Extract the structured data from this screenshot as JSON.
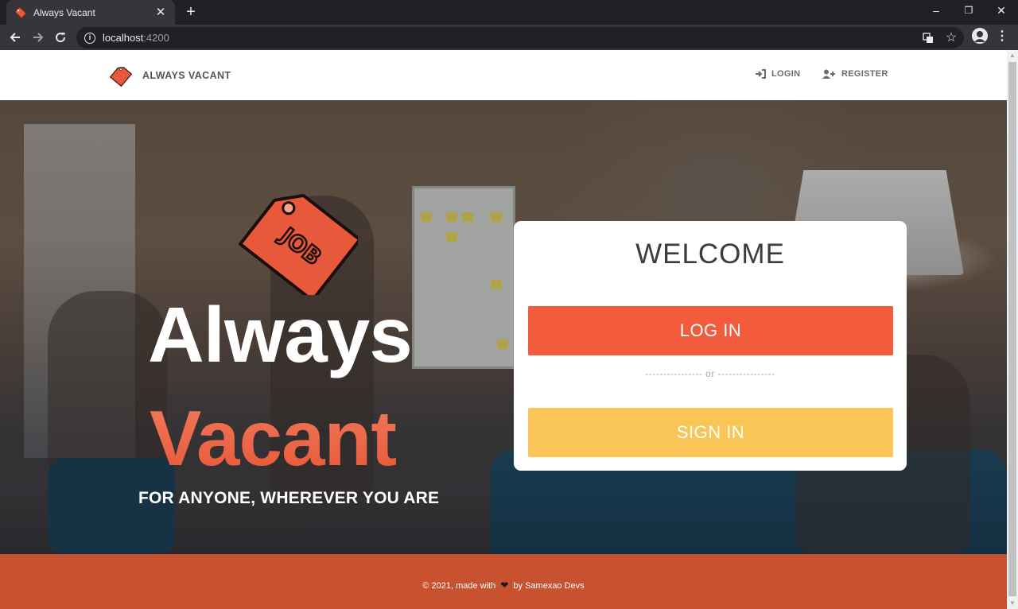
{
  "browser": {
    "tab_title": "Always Vacant",
    "tab_close": "✕",
    "new_tab": "+",
    "url_host": "localhost",
    "url_port": ":4200",
    "window_controls": {
      "minimize": "–",
      "restore": "❐",
      "close": "✕"
    }
  },
  "site_nav": {
    "brand_name": "ALWAYS VACANT",
    "login_label": "LOGIN",
    "register_label": "REGISTER"
  },
  "hero": {
    "title_line1": "Always",
    "title_line2": "Vacant",
    "subtitle": "FOR ANYONE, WHEREVER YOU ARE",
    "tag_text": "JOB"
  },
  "welcome_card": {
    "title": "WELCOME",
    "login_button": "LOG IN",
    "separator": "---------------- or ----------------",
    "signin_button": "SIGN IN"
  },
  "footer": {
    "prefix": "© 2021, made with",
    "suffix": "by Samexao Devs"
  },
  "colors": {
    "accent_orange": "#f25c3d",
    "accent_yellow": "#f9c556",
    "footer_bg": "#c8512f"
  }
}
